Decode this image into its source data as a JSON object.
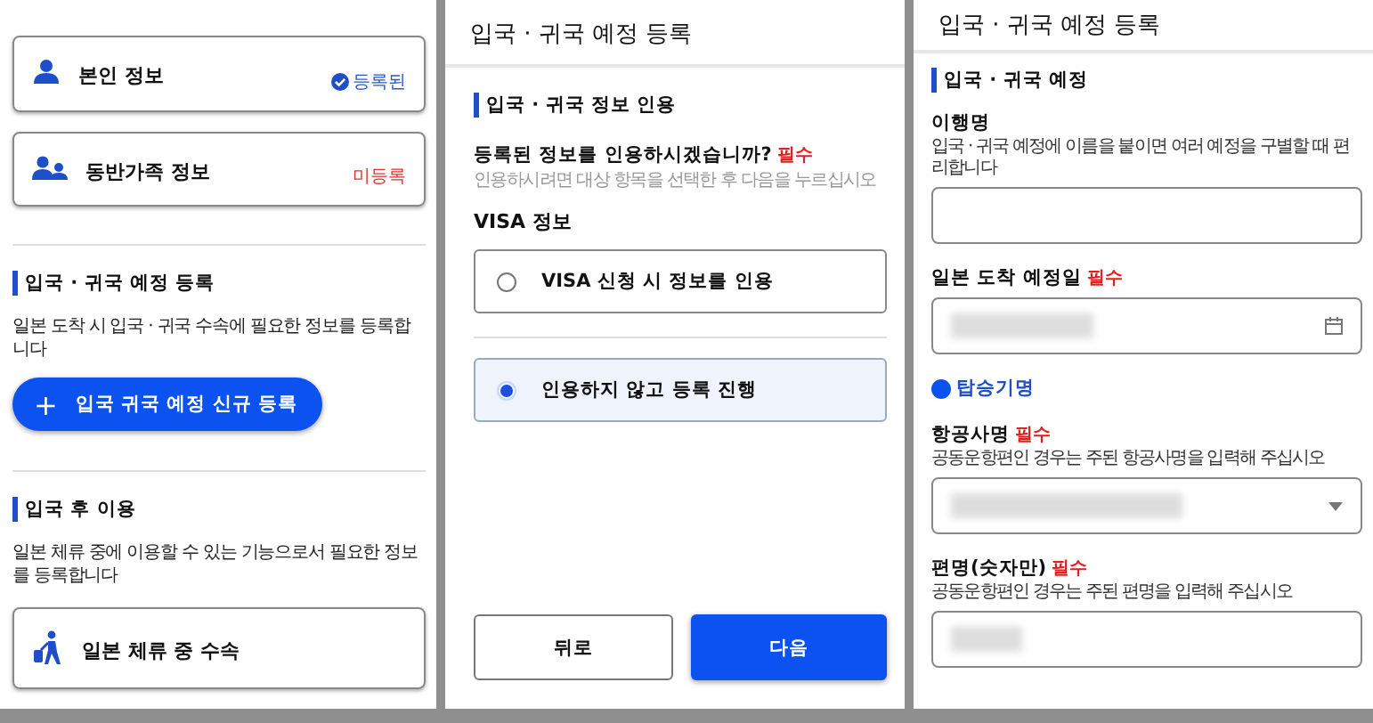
{
  "home": {
    "cards": [
      {
        "kind": "person",
        "title": "본인 정보",
        "status": "등록된",
        "registered": true
      },
      {
        "kind": "family",
        "title": "동반가족 정보",
        "status": "미등록",
        "registered": false
      }
    ],
    "sections": [
      {
        "heading": "입국 · 귀국 예정 등록",
        "description": "일본 도착 시 입국 · 귀국 수속에 필요한 정보를 등록합니다",
        "action": {
          "kind": "button",
          "label": "입국 귀국 예정 신규 등록",
          "icon": "+"
        }
      },
      {
        "heading": "입국 후 이용",
        "description": "일본 체류 중에 이용할 수 있는 기능으로서 필요한 정보를 등록합니다",
        "action": {
          "kind": "card",
          "label": "일본 체류 중 수속"
        }
      }
    ]
  },
  "quote_step": {
    "title": "입국 · 귀국 예정 등록",
    "heading": "입국 · 귀국 정보 인용",
    "question": "등록된 정보를 인용하시겠습니까?",
    "required_mark": "필수",
    "hint": "인용하시려면 대상 항목을 선택한 후 다음을 누르십시오",
    "group_label": "VISA 정보",
    "options": [
      {
        "label": "VISA 신청 시 정보를 인용",
        "selected": false
      },
      {
        "label": "인용하지 않고 등록 진행",
        "selected": true
      }
    ],
    "buttons": [
      {
        "label": "뒤로",
        "kind": "secondary"
      },
      {
        "label": "다음",
        "kind": "primary"
      }
    ]
  },
  "schedule_form": {
    "title": "입국 · 귀국 예정 등록",
    "heading": "입국 · 귀국 예정",
    "items": [
      {
        "kind": "text",
        "label": "이행명",
        "hint": "입국 · 귀국 예정에 이름을 붙이면 여러 예정을 구별할 때 편리합니다",
        "redacted": false
      },
      {
        "kind": "date",
        "label": "일본 도착 예정일",
        "required_mark": "필수",
        "redacted": true
      },
      {
        "kind": "subheading",
        "label": "탑승기명"
      },
      {
        "kind": "select",
        "label": "항공사명",
        "required_mark": "필수",
        "hint": "공동운항편인 경우는 주된 항공사명을 입력해 주십시오",
        "redacted": true
      },
      {
        "kind": "text",
        "label": "편명(숫자만)",
        "required_mark": "필수",
        "hint": "공동운항편인 경우는 주된 편명을 입력해 주십시오",
        "redacted": true
      }
    ]
  }
}
